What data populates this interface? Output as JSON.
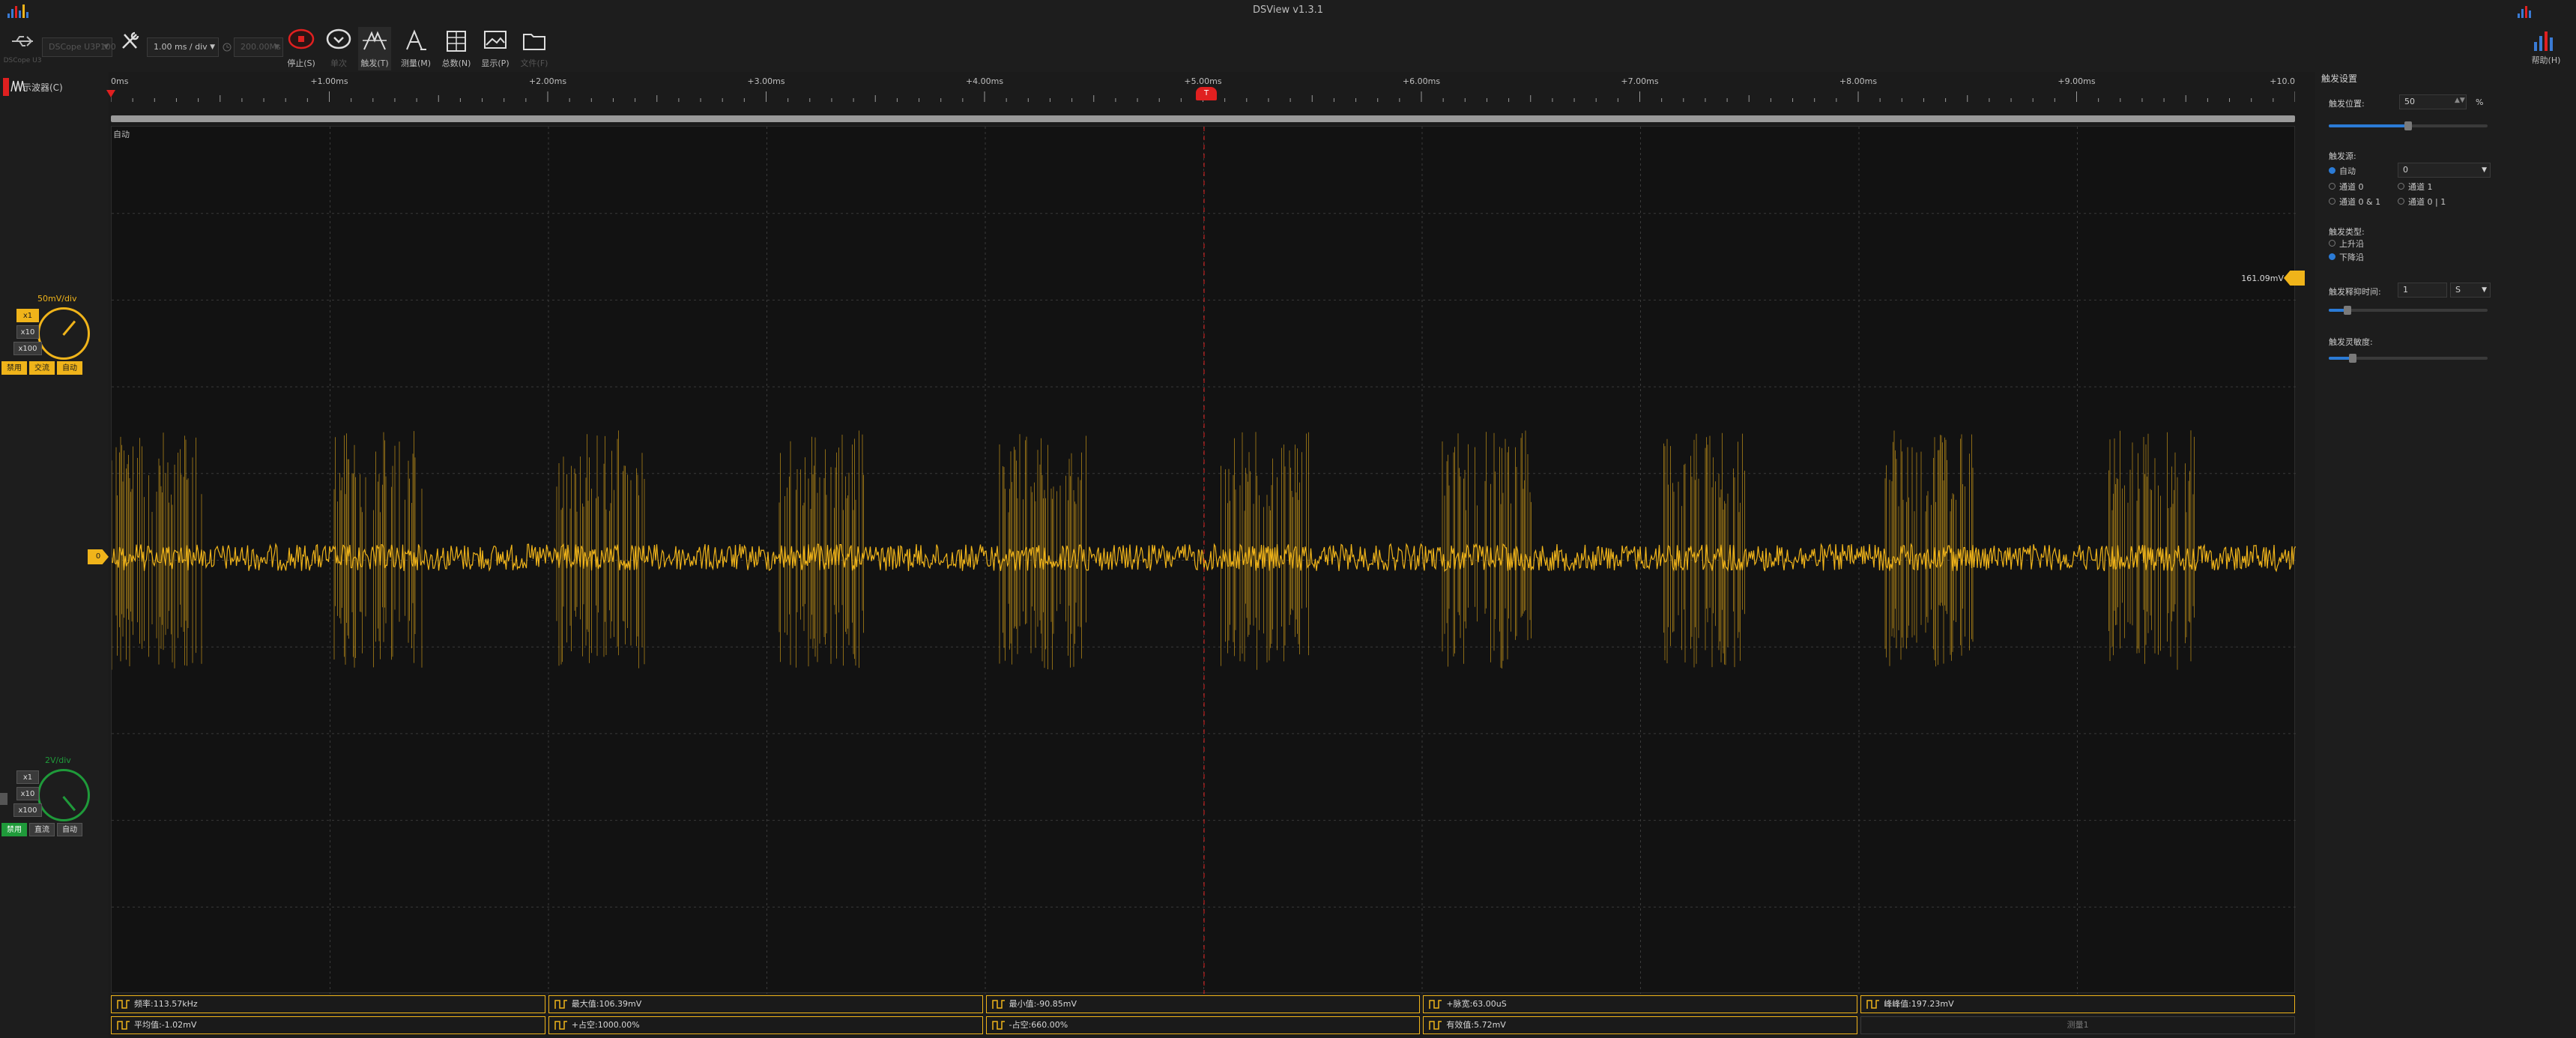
{
  "app": {
    "title": "DSView v1.3.1"
  },
  "toolbar": {
    "device_label": "DSCope U3P100",
    "device_sub": "DSCope U3",
    "tools_label": "",
    "timebase": "1.00 ms / div",
    "samplerate": "200.00Ms",
    "stop_label": "停止(S)",
    "single_label": "单次",
    "trigger_label": "触发(T)",
    "measure_label": "测量(M)",
    "decode_label": "总数(N)",
    "display_label": "显示(P)",
    "file_label": "文件(F)",
    "help_label": "帮助(H)"
  },
  "left": {
    "osc_label": "示波器(C)",
    "ch0": {
      "volt": "50mV/div",
      "b_x1": "x1",
      "b_x10": "x10",
      "b_x100": "x100",
      "m_disable": "禁用",
      "m_ac": "交流",
      "m_auto": "自动"
    },
    "ch1": {
      "volt": "2V/div",
      "b_x1": "x1",
      "b_x10": "x10",
      "b_x100": "x100",
      "m_disable": "禁用",
      "m_dc": "直流",
      "m_auto": "自动"
    },
    "ch0_marker": "0",
    "ch1_marker": ""
  },
  "ruler": {
    "ticks": [
      "0ms",
      "+1.00ms",
      "+2.00ms",
      "+3.00ms",
      "+4.00ms",
      "+5.00ms",
      "+6.00ms",
      "+7.00ms",
      "+8.00ms",
      "+9.00ms",
      "+10.0"
    ]
  },
  "plot": {
    "status": "自动",
    "trigger_level": "161.09mV",
    "trigger_marker": "T",
    "trace_color": "#f0b41a"
  },
  "measurements": [
    {
      "icon": "frequency-icon",
      "text": "频率:113.57kHz"
    },
    {
      "icon": "maximum-icon",
      "text": "最大值:106.39mV"
    },
    {
      "icon": "minimum-icon",
      "text": "最小值:-90.85mV"
    },
    {
      "icon": "pulse-width-icon",
      "text": "+脉宽:63.00uS"
    },
    {
      "icon": "peak-to-peak-icon",
      "text": "峰峰值:197.23mV"
    },
    {
      "icon": "average-icon",
      "text": "平均值:-1.02mV"
    },
    {
      "icon": "duty-positive-icon",
      "text": "+占空:1000.00%"
    },
    {
      "icon": "duty-negative-icon",
      "text": "-占空:660.00%"
    },
    {
      "icon": "rms-icon",
      "text": "有效值:5.72mV"
    },
    {
      "icon": "",
      "text": "测量1"
    }
  ],
  "trigger_panel": {
    "title": "触发设置",
    "position_label": "触发位置:",
    "position_value": "50",
    "position_unit": "%",
    "position_fraction": 0.5,
    "source_label": "触发源:",
    "src_auto": "自动",
    "src_auto_value": "0",
    "src_ch0": "通道 0",
    "src_ch1": "通道 1",
    "src_ch0_and_1": "通道 0 & 1",
    "src_ch0_or_1": "通道 0 | 1",
    "type_label": "触发类型:",
    "type_rising": "上升沿",
    "type_falling": "下降沿",
    "holdoff_label": "触发释抑时间:",
    "holdoff_value": "1",
    "holdoff_unit": "S",
    "holdoff_fraction": 0.12,
    "sensitivity_label": "触发灵敏度:",
    "sensitivity_fraction": 0.15
  },
  "colors": {
    "accent": "#f0b41a",
    "trigger": "#e02020",
    "selected": "#2b7bd6",
    "ch1": "#1f9a3a"
  }
}
